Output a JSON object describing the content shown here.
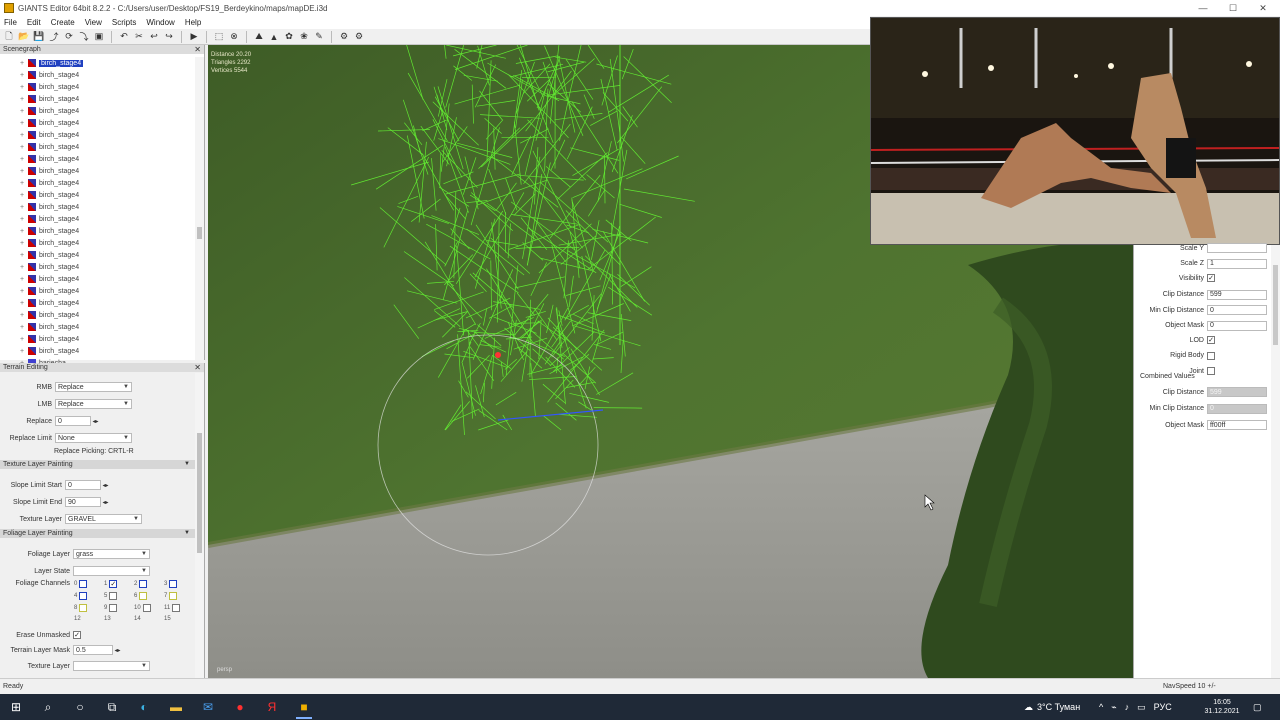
{
  "window": {
    "title": "GIANTS Editor 64bit 8.2.2 - C:/Users/user/Desktop/FS19_Berdeykino/maps/mapDE.i3d"
  },
  "menu": [
    "File",
    "Edit",
    "Create",
    "View",
    "Scripts",
    "Window",
    "Help"
  ],
  "scenegraph": {
    "title": "Scenegraph",
    "items": [
      {
        "label": "birch_stage4",
        "selected": true,
        "icon": "transform-group-icon"
      },
      {
        "label": "birch_stage4",
        "icon": "transform-group-icon"
      },
      {
        "label": "birch_stage4",
        "icon": "transform-group-icon"
      },
      {
        "label": "birch_stage4",
        "icon": "transform-group-icon"
      },
      {
        "label": "birch_stage4",
        "icon": "transform-group-icon"
      },
      {
        "label": "birch_stage4",
        "icon": "transform-group-icon"
      },
      {
        "label": "birch_stage4",
        "icon": "transform-group-icon"
      },
      {
        "label": "birch_stage4",
        "icon": "transform-group-icon"
      },
      {
        "label": "birch_stage4",
        "icon": "transform-group-icon"
      },
      {
        "label": "birch_stage4",
        "icon": "transform-group-icon"
      },
      {
        "label": "birch_stage4",
        "icon": "transform-group-icon"
      },
      {
        "label": "birch_stage4",
        "icon": "transform-group-icon"
      },
      {
        "label": "birch_stage4",
        "icon": "transform-group-icon"
      },
      {
        "label": "birch_stage4",
        "icon": "transform-group-icon"
      },
      {
        "label": "birch_stage4",
        "icon": "transform-group-icon"
      },
      {
        "label": "birch_stage4",
        "icon": "transform-group-icon"
      },
      {
        "label": "birch_stage4",
        "icon": "transform-group-icon"
      },
      {
        "label": "birch_stage4",
        "icon": "transform-group-icon"
      },
      {
        "label": "birch_stage4",
        "icon": "transform-group-icon"
      },
      {
        "label": "birch_stage4",
        "icon": "transform-group-icon"
      },
      {
        "label": "birch_stage4",
        "icon": "transform-group-icon"
      },
      {
        "label": "birch_stage4",
        "icon": "transform-group-icon"
      },
      {
        "label": "birch_stage4",
        "icon": "transform-group-icon"
      },
      {
        "label": "birch_stage4",
        "icon": "transform-group-icon"
      },
      {
        "label": "birch_stage4",
        "icon": "transform-group-icon"
      },
      {
        "label": "bariecha",
        "icon": "shape-icon"
      },
      {
        "label": "bariecha",
        "icon": "shape-icon"
      },
      {
        "label": "birch_stage4",
        "icon": "transform-group-icon"
      }
    ]
  },
  "terrain": {
    "title": "Terrain Editing",
    "rmb_label": "RMB",
    "rmb_value": "Replace",
    "lmb_label": "LMB",
    "lmb_value": "Replace",
    "replace_label": "Replace",
    "replace_value": "0",
    "replace_limit_label": "Replace Limit",
    "replace_limit_value": "None",
    "replace_picking_hint": "Replace Picking: CRTL-R",
    "texture_section": "Texture Layer Painting",
    "slope_start_label": "Slope Limit Start",
    "slope_start_value": "0",
    "slope_end_label": "Slope Limit End",
    "slope_end_value": "90",
    "texture_layer_label": "Texture Layer",
    "texture_layer_value": "GRAVEL",
    "foliage_section": "Foliage Layer Painting",
    "foliage_layer_label": "Foliage Layer",
    "foliage_layer_value": "grass",
    "layer_state_label": "Layer State",
    "foliage_channels_label": "Foliage Channels",
    "channels": [
      "0",
      "1",
      "2",
      "3",
      "4",
      "5",
      "6",
      "7",
      "8",
      "9",
      "10",
      "11",
      "12",
      "13",
      "14",
      "15"
    ],
    "erase_unmasked_label": "Erase Unmasked",
    "terrain_mask_label": "Terrain Layer Mask",
    "terrain_mask_value": "0.5",
    "texture_layer2_label": "Texture Layer"
  },
  "viewport": {
    "stats": [
      "Distance 20.20",
      "Triangles 2292",
      "Vertices 5544"
    ],
    "camera": "persp"
  },
  "attributes": {
    "rows": [
      {
        "label": "Scale Y",
        "value": ""
      },
      {
        "label": "Scale Z",
        "value": "1"
      },
      {
        "label": "Visibility",
        "value": "✓"
      },
      {
        "label": "Clip Distance",
        "value": "599"
      },
      {
        "label": "Min Clip Distance",
        "value": "0"
      },
      {
        "label": "Object Mask",
        "value": "0"
      },
      {
        "label": "LOD",
        "value": "✓"
      },
      {
        "label": "Rigid Body",
        "value": ""
      },
      {
        "label": "Joint",
        "value": ""
      }
    ],
    "combined_label": "Combined Values",
    "combined_rows": [
      {
        "label": "Clip Distance",
        "value": "599"
      },
      {
        "label": "Min Clip Distance",
        "value": "0"
      },
      {
        "label": "Object Mask",
        "value": "ff00ff"
      }
    ]
  },
  "status": {
    "ready": "Ready",
    "nav_speed": "NavSpeed 10 +/-"
  },
  "taskbar": {
    "weather": "3°C Туман",
    "lang": "РУС",
    "time": "16:05",
    "date": "31.12.2021"
  },
  "colors": {
    "selection": "#2040c0",
    "wireframe": "#66ff33",
    "grass": "#4a6a2c",
    "road": "#9a9a94"
  }
}
